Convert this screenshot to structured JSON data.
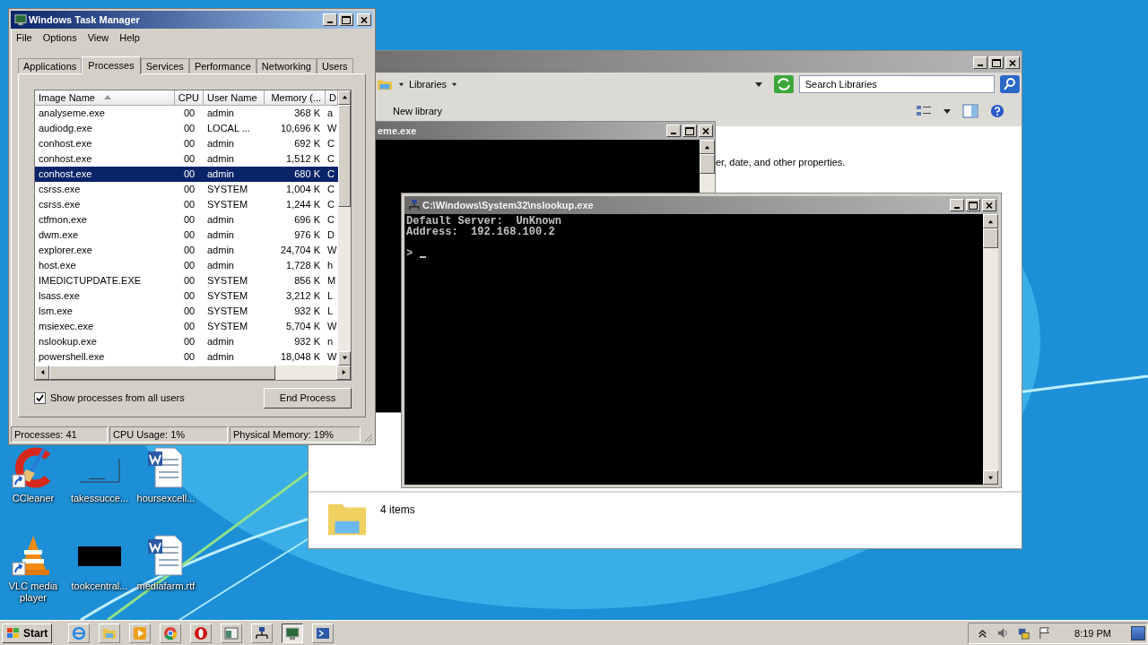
{
  "desktop_icons": [
    {
      "kind": "ccleaner",
      "label": "CCleaner",
      "shortcut": true
    },
    {
      "kind": "blank",
      "label": "takessucce...",
      "shortcut": false
    },
    {
      "kind": "word",
      "label": "hoursexcell...",
      "shortcut": false
    },
    {
      "kind": "vlc",
      "label": "VLC media player",
      "shortcut": true
    },
    {
      "kind": "black",
      "label": "tookcentral...",
      "shortcut": false
    },
    {
      "kind": "word",
      "label": "mediafarm.rtf",
      "shortcut": false
    }
  ],
  "explorer": {
    "active": false,
    "breadcrumb": "Libraries",
    "search": {
      "placeholder": "Search Libraries"
    },
    "toolbar_button": "New library",
    "content_text": "er, date, and other properties.",
    "status": "4 items"
  },
  "console_back": {
    "active": false,
    "title": "eme.exe"
  },
  "console_front": {
    "active": false,
    "title": "C:\\Windows\\System32\\nslookup.exe",
    "lines": [
      "Default Server:  UnKnown",
      "Address:  192.168.100.2"
    ],
    "prompt": ">"
  },
  "task_manager": {
    "active": true,
    "title": "Windows Task Manager",
    "menu": [
      "File",
      "Options",
      "View",
      "Help"
    ],
    "tabs": [
      {
        "label": "Applications",
        "selected": false
      },
      {
        "label": "Processes",
        "selected": true
      },
      {
        "label": "Services",
        "selected": false
      },
      {
        "label": "Performance",
        "selected": false
      },
      {
        "label": "Networking",
        "selected": false
      },
      {
        "label": "Users",
        "selected": false
      }
    ],
    "columns": [
      "Image Name",
      "CPU",
      "User Name",
      "Memory (...",
      "D"
    ],
    "rows": [
      {
        "cells": [
          "analyseme.exe",
          "00",
          "admin",
          "368 K",
          "a"
        ],
        "selected": false
      },
      {
        "cells": [
          "audiodg.exe",
          "00",
          "LOCAL ...",
          "10,696 K",
          "W"
        ],
        "selected": false
      },
      {
        "cells": [
          "conhost.exe",
          "00",
          "admin",
          "692 K",
          "C"
        ],
        "selected": false
      },
      {
        "cells": [
          "conhost.exe",
          "00",
          "admin",
          "1,512 K",
          "C"
        ],
        "selected": false
      },
      {
        "cells": [
          "conhost.exe",
          "00",
          "admin",
          "680 K",
          "C"
        ],
        "selected": true
      },
      {
        "cells": [
          "csrss.exe",
          "00",
          "SYSTEM",
          "1,004 K",
          "C"
        ],
        "selected": false
      },
      {
        "cells": [
          "csrss.exe",
          "00",
          "SYSTEM",
          "1,244 K",
          "C"
        ],
        "selected": false
      },
      {
        "cells": [
          "ctfmon.exe",
          "00",
          "admin",
          "696 K",
          "C"
        ],
        "selected": false
      },
      {
        "cells": [
          "dwm.exe",
          "00",
          "admin",
          "976 K",
          "D"
        ],
        "selected": false
      },
      {
        "cells": [
          "explorer.exe",
          "00",
          "admin",
          "24,704 K",
          "W"
        ],
        "selected": false
      },
      {
        "cells": [
          "host.exe",
          "00",
          "admin",
          "1,728 K",
          "h"
        ],
        "selected": false
      },
      {
        "cells": [
          "IMEDICTUPDATE.EXE",
          "00",
          "SYSTEM",
          "856 K",
          "M"
        ],
        "selected": false
      },
      {
        "cells": [
          "lsass.exe",
          "00",
          "SYSTEM",
          "3,212 K",
          "L"
        ],
        "selected": false
      },
      {
        "cells": [
          "lsm.exe",
          "00",
          "SYSTEM",
          "932 K",
          "L"
        ],
        "selected": false
      },
      {
        "cells": [
          "msiexec.exe",
          "00",
          "SYSTEM",
          "5,704 K",
          "W"
        ],
        "selected": false
      },
      {
        "cells": [
          "nslookup.exe",
          "00",
          "admin",
          "932 K",
          "n"
        ],
        "selected": false
      },
      {
        "cells": [
          "powershell.exe",
          "00",
          "admin",
          "18,048 K",
          "W"
        ],
        "selected": false
      }
    ],
    "show_all_users": {
      "label": "Show processes from all users",
      "checked": true
    },
    "end_button": "End Process",
    "status_bar": [
      "Processes: 41",
      "CPU Usage: 1%",
      "Physical Memory: 19%"
    ]
  },
  "taskbar": {
    "start": "Start",
    "clock": "8:19 PM",
    "apps": [
      {
        "kind": "ie",
        "active": false
      },
      {
        "kind": "folder",
        "active": false
      },
      {
        "kind": "media",
        "active": false
      },
      {
        "kind": "chrome",
        "active": false
      },
      {
        "kind": "opera",
        "active": false
      },
      {
        "kind": "window",
        "active": false
      },
      {
        "kind": "network",
        "active": false
      },
      {
        "kind": "monitor",
        "active": true
      },
      {
        "kind": "shell",
        "active": false
      }
    ]
  }
}
